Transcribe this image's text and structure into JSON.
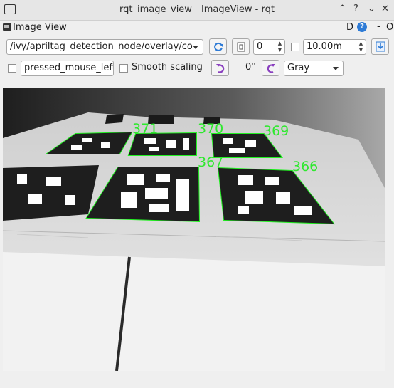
{
  "window": {
    "title": "rqt_image_view__ImageView - rqt",
    "buttons": {
      "pin": "⌃",
      "help": "?",
      "minimize": "⌄",
      "close": "✕"
    }
  },
  "dock": {
    "title": "Image View",
    "d_label": "D",
    "help_label": "?",
    "dash_label": "-",
    "o_label": "O"
  },
  "toolbar": {
    "topic": "/ivy/apriltag_detection_node/overlay/co",
    "refresh_icon": "refresh-icon",
    "smooth_icon": "zoom-fit-icon",
    "spin_value": "0",
    "spin_checked": false,
    "max_range": "10.00m",
    "save_icon": "save-icon",
    "mouse_topic": "pressed_mouse_left",
    "mouse_checked": false,
    "smooth_scaling_label": "Smooth scaling",
    "smooth_scaling_checked": false,
    "rotate_ccw_icon": "rotate-left-icon",
    "rotation_value": "0°",
    "rotate_cw_icon": "rotate-right-icon",
    "color_scheme": "Gray"
  },
  "image": {
    "tags": [
      {
        "id": "371"
      },
      {
        "id": "370"
      },
      {
        "id": "369"
      },
      {
        "id": "367"
      },
      {
        "id": "366"
      }
    ]
  },
  "colors": {
    "accent": "#2e7bd6",
    "detection": "#22f022",
    "rotate_icons": "#8a3fbf"
  }
}
